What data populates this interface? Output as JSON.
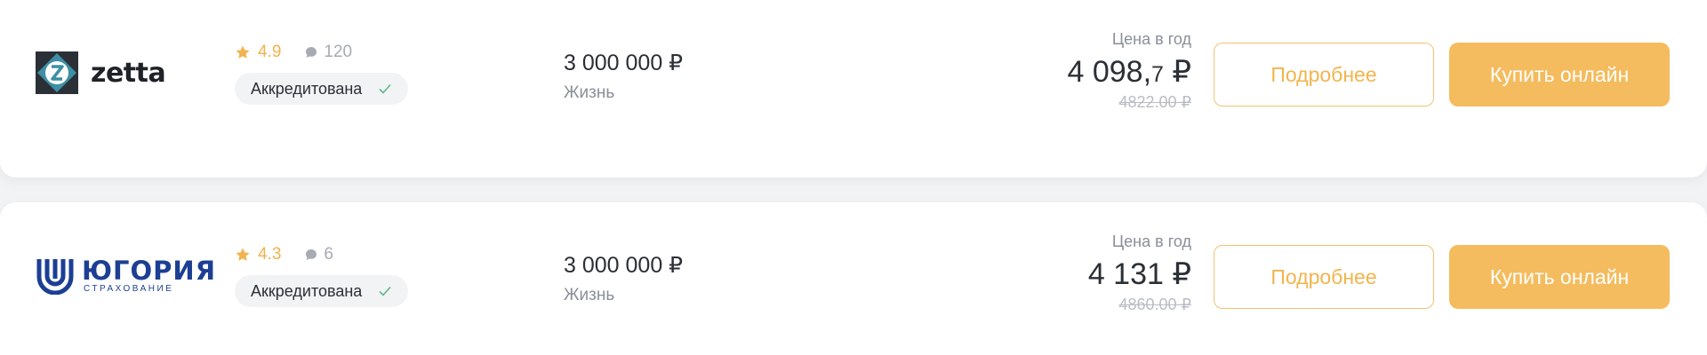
{
  "offers": [
    {
      "company": "zetta",
      "rating": "4.9",
      "reviews": "120",
      "badge": "Аккредитована",
      "coverage": "3 000 000 ₽",
      "coverage_type": "Жизнь",
      "price_label": "Цена в год",
      "price_int": "4 098,",
      "price_dec": "7",
      "price_currency": " ₽",
      "price_old": "4822.00 ₽",
      "details_label": "Подробнее",
      "buy_label": "Купить онлайн"
    },
    {
      "company": "ЮГОРИЯ",
      "company_sub": "СТРАХОВАНИЕ",
      "rating": "4.3",
      "reviews": "6",
      "badge": "Аккредитована",
      "coverage": "3 000 000 ₽",
      "coverage_type": "Жизнь",
      "price_label": "Цена в год",
      "price_int": "4 131",
      "price_currency": " ₽",
      "price_old": "4860.00 ₽",
      "details_label": "Подробнее",
      "buy_label": "Купить онлайн"
    }
  ],
  "colors": {
    "accent": "#f4bc5e",
    "rating": "#f2b24c",
    "check": "#5cb88a",
    "zetta_brand": "#3e8fa3",
    "yugoria_brand": "#1c3f94"
  },
  "icons": [
    "star-icon",
    "comment-icon",
    "check-icon"
  ]
}
